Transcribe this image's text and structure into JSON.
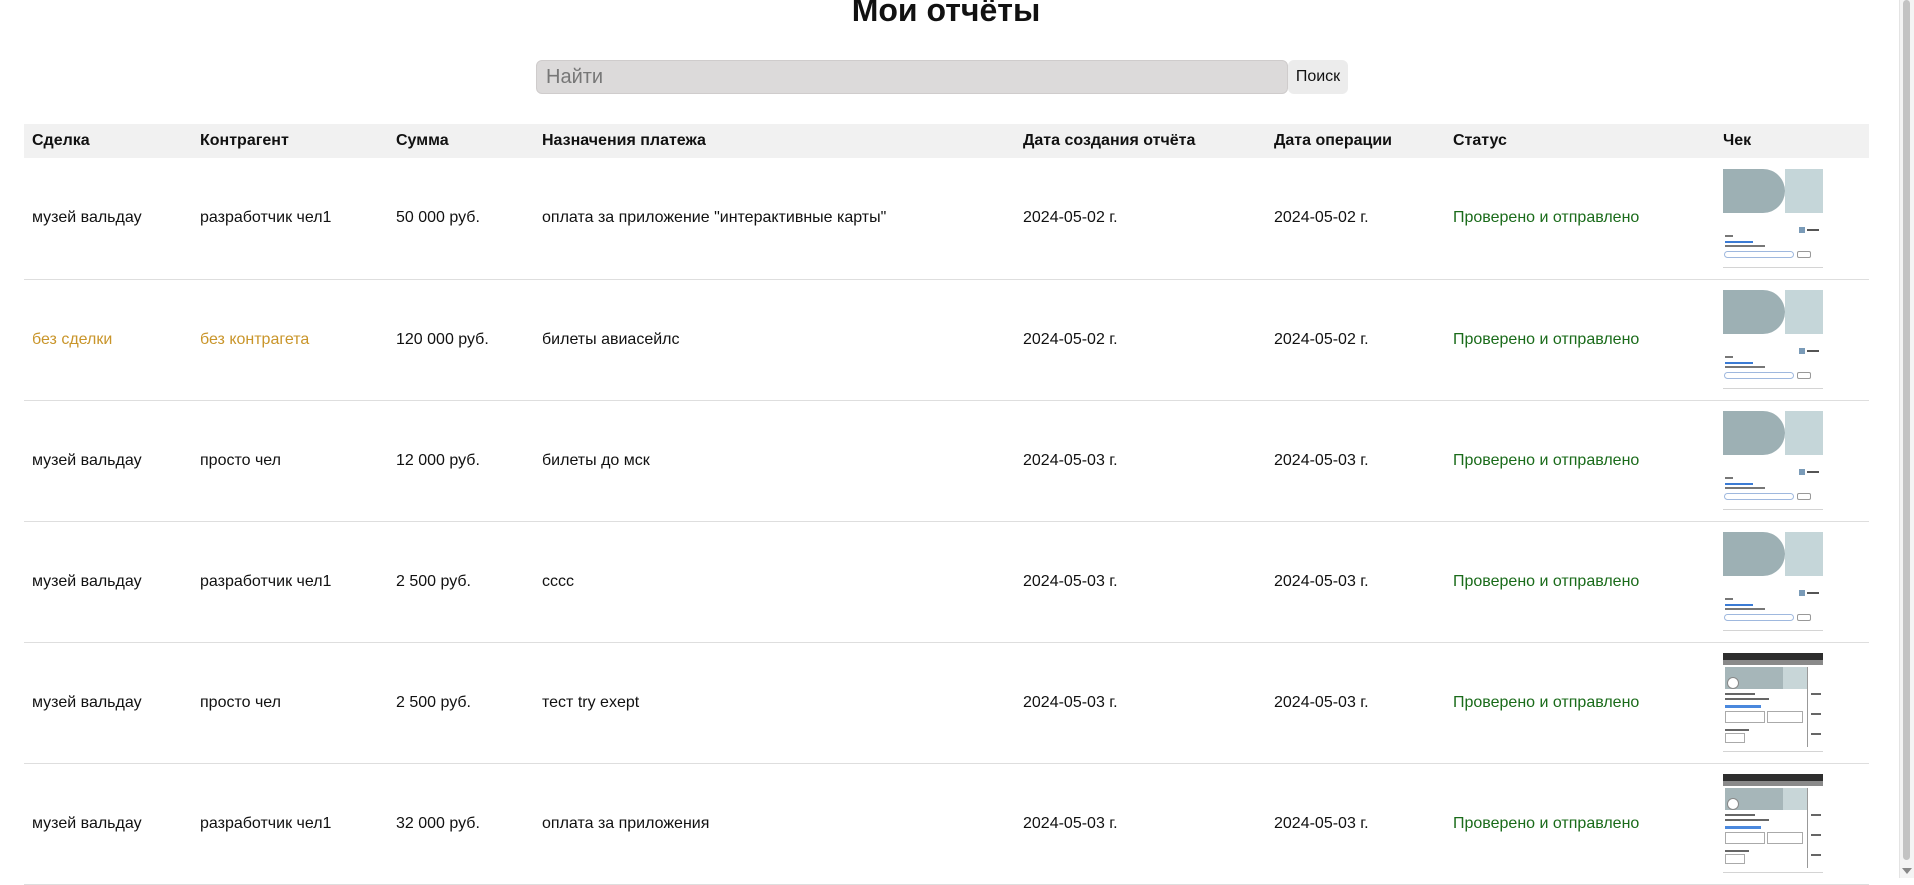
{
  "page": {
    "title": "Мои отчёты"
  },
  "search": {
    "placeholder": "Найти",
    "value": "",
    "button_label": "Поиск"
  },
  "table": {
    "headers": {
      "deal": "Сделка",
      "counterparty": "Контрагент",
      "amount": "Сумма",
      "purpose": "Назначения платежа",
      "report_date": "Дата создания отчёта",
      "operation_date": "Дата операции",
      "status": "Статус",
      "receipt": "Чек"
    },
    "rows": [
      {
        "deal": "музей вальдау",
        "counterparty": "разработчик чел1",
        "amount": "50 000 руб.",
        "purpose": "оплата за приложение \"интерактивные карты\"",
        "report_date": "2024-05-02 г.",
        "operation_date": "2024-05-02 г.",
        "status": "Проверено и отправлено"
      },
      {
        "deal": "без сделки",
        "counterparty": "без контрагета",
        "amount": "120 000 руб.",
        "purpose": "билеты авиасейлс",
        "report_date": "2024-05-02 г.",
        "operation_date": "2024-05-02 г.",
        "status": "Проверено и отправлено"
      },
      {
        "deal": "музей вальдау",
        "counterparty": "просто чел",
        "amount": "12 000 руб.",
        "purpose": "билеты до мск",
        "report_date": "2024-05-03 г.",
        "operation_date": "2024-05-03 г.",
        "status": "Проверено и отправлено"
      },
      {
        "deal": "музей вальдау",
        "counterparty": "разработчик чел1",
        "amount": "2 500 руб.",
        "purpose": "сссс",
        "report_date": "2024-05-03 г.",
        "operation_date": "2024-05-03 г.",
        "status": "Проверено и отправлено"
      },
      {
        "deal": "музей вальдау",
        "counterparty": "просто чел",
        "amount": "2 500 руб.",
        "purpose": "тест try exept",
        "report_date": "2024-05-03 г.",
        "operation_date": "2024-05-03 г.",
        "status": "Проверено и отправлено"
      },
      {
        "deal": "музей вальдау",
        "counterparty": "разработчик чел1",
        "amount": "32 000 руб.",
        "purpose": "оплата за приложения",
        "report_date": "2024-05-03 г.",
        "operation_date": "2024-05-03 г.",
        "status": "Проверено и отправлено"
      }
    ]
  },
  "colors": {
    "status_ok": "#1a6b1a",
    "muted_value": "#c9952a",
    "header_bg": "#f1f1f1",
    "search_bg": "#dcdada"
  }
}
